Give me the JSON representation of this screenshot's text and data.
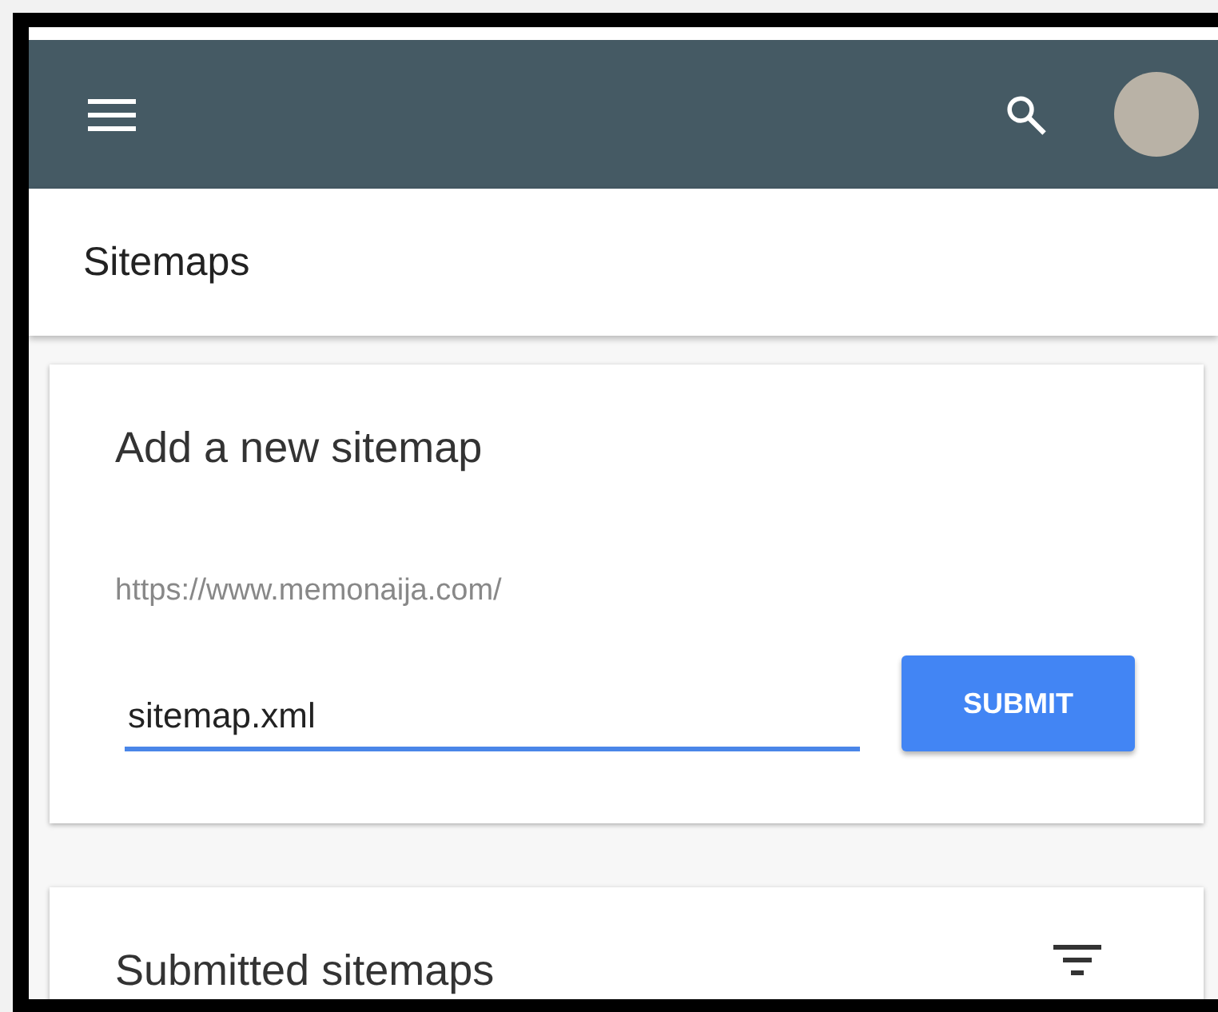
{
  "header": {
    "title": "Sitemaps"
  },
  "add_sitemap": {
    "title": "Add a new sitemap",
    "url_prefix": "https://www.memonaija.com/",
    "input_value": "sitemap.xml",
    "button": "SUBMIT"
  },
  "submitted_sitemaps": {
    "title": "Submitted sitemaps"
  }
}
